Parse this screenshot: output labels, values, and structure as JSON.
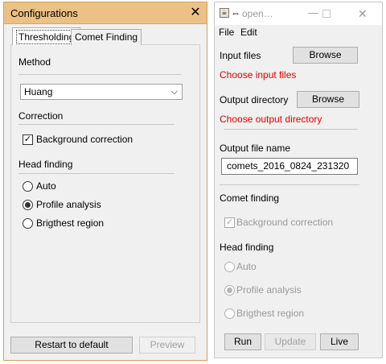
{
  "config_dialog": {
    "title": "Configurations",
    "close_glyph": "✕",
    "tabs": [
      "Thresholding",
      "Comet Finding"
    ],
    "method_label": "Method",
    "method_value": "Huang",
    "correction_label": "Correction",
    "background_correction": {
      "label": "Background correction",
      "checked": true
    },
    "head_finding_label": "Head finding",
    "head_options": [
      {
        "label": "Auto",
        "selected": false
      },
      {
        "label": "Profile analysis",
        "selected": true
      },
      {
        "label": "Brigthest region",
        "selected": false
      }
    ],
    "restart_button": "Restart to default",
    "preview_button": "Preview"
  },
  "main_window": {
    "title": "open…",
    "arrows_glyph": "⇔",
    "menu": [
      "File",
      "Edit"
    ],
    "input_files_label": "Input files",
    "browse_label": "Browse",
    "input_files_status": "Choose input files",
    "output_dir_label": "Output directory",
    "output_dir_status": "Choose output directory",
    "output_file_name_label": "Output file name",
    "output_file_name_value": "comets_2016_0824_231320",
    "comet_finding_label": "Comet finding",
    "background_correction": {
      "label": "Background correction",
      "checked": true
    },
    "head_finding_label": "Head finding",
    "head_options": [
      {
        "label": "Auto",
        "selected": false
      },
      {
        "label": "Profile analysis",
        "selected": true
      },
      {
        "label": "Brigthest region",
        "selected": false
      }
    ],
    "run_button": "Run",
    "update_button": "Update",
    "live_button": "Live"
  },
  "colors": {
    "dialog_title_bg": "#ebc185",
    "dialog_border": "#d6a05a",
    "error_text": "#e00000"
  }
}
